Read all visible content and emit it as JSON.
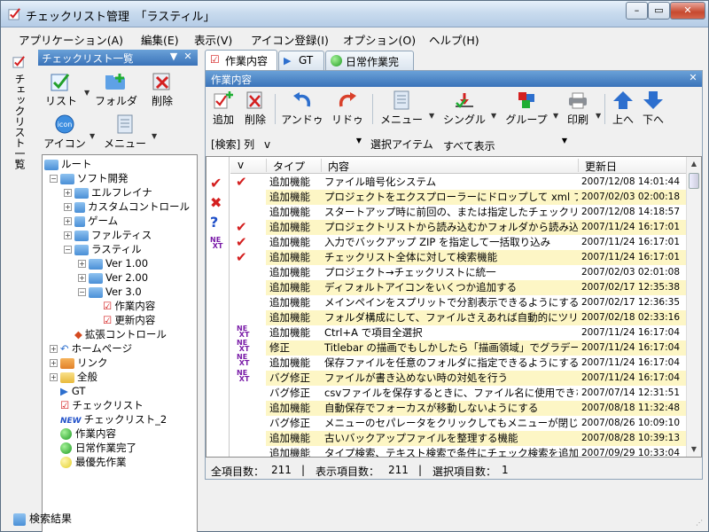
{
  "window": {
    "title": "チェックリスト管理　「ラスティル」",
    "min": "–",
    "max": "▭",
    "close": "✕"
  },
  "menu": [
    "アプリケーション(A)",
    "編集(E)",
    "表示(V)",
    "アイコン登録(I)",
    "オプション(O)",
    "ヘルプ(H)"
  ],
  "side_tab": {
    "label": "チェックリスト一覧"
  },
  "left_panel": {
    "title": "チェックリスト一覧",
    "pin": "▼",
    "close": "✕",
    "toolbar": [
      {
        "label": "リスト",
        "icon": "checklist-icon"
      },
      {
        "label": "フォルダ",
        "icon": "folder-add-icon"
      },
      {
        "label": "削除",
        "icon": "delete-icon"
      },
      {
        "label": "アイコン",
        "icon": "icon-register-icon"
      },
      {
        "label": "メニュー",
        "icon": "menu-icon"
      }
    ],
    "tree": [
      {
        "label": "ルート",
        "level": 0,
        "exp": "",
        "icon": "folder-blue"
      },
      {
        "label": "ソフト開発",
        "level": 1,
        "exp": "−",
        "icon": "folder-blue"
      },
      {
        "label": "エルフレイナ",
        "level": 2,
        "exp": "+",
        "icon": "folder-blue"
      },
      {
        "label": "カスタムコントロール",
        "level": 2,
        "exp": "+",
        "icon": "flag-blue"
      },
      {
        "label": "ゲーム",
        "level": 2,
        "exp": "+",
        "icon": "flag-blue"
      },
      {
        "label": "ファルティス",
        "level": 2,
        "exp": "+",
        "icon": "folder-blue"
      },
      {
        "label": "ラスティル",
        "level": 2,
        "exp": "−",
        "icon": "folder-blue"
      },
      {
        "label": "Ver 1.00",
        "level": 3,
        "exp": "+",
        "icon": "folder-blue"
      },
      {
        "label": "Ver 2.00",
        "level": 3,
        "exp": "+",
        "icon": "folder-blue"
      },
      {
        "label": "Ver 3.0",
        "level": 3,
        "exp": "−",
        "icon": "folder-blue"
      },
      {
        "label": "作業内容",
        "level": 4,
        "exp": "",
        "icon": "check"
      },
      {
        "label": "更新内容",
        "level": 4,
        "exp": "",
        "icon": "check"
      },
      {
        "label": "拡張コントロール",
        "level": 2,
        "exp": "",
        "icon": "multi"
      },
      {
        "label": "ホームページ",
        "level": 1,
        "exp": "+",
        "icon": "undo"
      },
      {
        "label": "リンク",
        "level": 1,
        "exp": "+",
        "icon": "folder-orange"
      },
      {
        "label": "全般",
        "level": 1,
        "exp": "+",
        "icon": "folder-yellow"
      },
      {
        "label": "GT",
        "level": 1,
        "exp": "",
        "icon": "arrow"
      },
      {
        "label": "チェックリスト",
        "level": 1,
        "exp": "",
        "icon": "check"
      },
      {
        "label": "チェックリスト_2",
        "level": 1,
        "exp": "",
        "icon": "new"
      },
      {
        "label": "作業内容",
        "level": 1,
        "exp": "",
        "icon": "green"
      },
      {
        "label": "日常作業完了",
        "level": 1,
        "exp": "",
        "icon": "green"
      },
      {
        "label": "最優先作業",
        "level": 1,
        "exp": "",
        "icon": "yellow"
      }
    ]
  },
  "tabs": [
    {
      "label": "作業内容",
      "icon": "check-icon"
    },
    {
      "label": "GT",
      "icon": "arrow-icon"
    },
    {
      "label": "日常作業完了",
      "icon": "green-dot-icon"
    }
  ],
  "pane": {
    "title": "作業内容",
    "close": "✕",
    "toolbar": [
      {
        "label": "追加",
        "icon": "add-icon"
      },
      {
        "label": "削除",
        "icon": "delete-icon"
      },
      {
        "label": "アンドゥ",
        "icon": "undo-icon"
      },
      {
        "label": "リドゥ",
        "icon": "redo-icon"
      },
      {
        "label": "メニュー",
        "icon": "menu-icon"
      },
      {
        "label": "シングル",
        "icon": "single-icon"
      },
      {
        "label": "グループ",
        "icon": "group-icon"
      },
      {
        "label": "印刷",
        "icon": "print-icon"
      },
      {
        "label": "上へ",
        "icon": "up-icon"
      },
      {
        "label": "下へ",
        "icon": "down-icon"
      }
    ],
    "filter": {
      "label": "[検索] 列",
      "column": "v",
      "item_label": "選択アイテム",
      "item": "すべて表示"
    },
    "columns": [
      "v",
      "タイプ",
      "内容",
      "更新日"
    ],
    "rows": [
      {
        "c": true,
        "t": "追加機能",
        "x": "ファイル暗号化システム",
        "d": "2007/12/08 14:01:44",
        "h": false
      },
      {
        "c": false,
        "t": "追加機能",
        "x": "プロジェクトをエクスプローラーにドロップして xml ファイル外部…",
        "d": "2007/02/03 02:00:18",
        "h": true
      },
      {
        "c": false,
        "t": "追加機能",
        "x": "スタートアップ時に前回の、または指定したチェックリストを自動…",
        "d": "2007/12/08 14:18:57",
        "h": false
      },
      {
        "c": true,
        "t": "追加機能",
        "x": "プロジェクトリストから読み込むかフォルダから読み込むかを選…",
        "d": "2007/11/24 16:17:01",
        "h": true
      },
      {
        "c": true,
        "t": "追加機能",
        "x": "入力でバックアップ ZIP を指定して一括取り込み",
        "d": "2007/11/24 16:17:01",
        "h": false
      },
      {
        "c": true,
        "t": "追加機能",
        "x": "チェックリスト全体に対して検索機能",
        "d": "2007/11/24 16:17:01",
        "h": true
      },
      {
        "c": false,
        "t": "追加機能",
        "x": "プロジェクト→チェックリストに統一",
        "d": "2007/02/03 02:01:08",
        "h": false
      },
      {
        "c": false,
        "t": "追加機能",
        "x": "ディフォルトアイコンをいくつか追加する",
        "d": "2007/02/17 12:35:38",
        "h": true
      },
      {
        "c": false,
        "t": "追加機能",
        "x": "メインペインをスプリットで分割表示できるようにする",
        "d": "2007/02/17 12:36:35",
        "h": false
      },
      {
        "c": false,
        "t": "追加機能",
        "x": "フォルダ構成にして、ファイルさえあれば自動的にツリーに表示…",
        "d": "2007/02/18 02:33:16",
        "h": true
      },
      {
        "c": false,
        "t": "追加機能",
        "x": "Ctrl+A で項目全選択",
        "d": "2007/11/24 16:17:04",
        "h": false
      },
      {
        "c": false,
        "t": "修正",
        "x": "Titlebar の描画でもしかしたら「描画領域」でグラデーション…",
        "d": "2007/11/24 16:17:04",
        "h": true
      },
      {
        "c": false,
        "t": "追加機能",
        "x": "保存ファイルを任意のフォルダに指定できるようにする",
        "d": "2007/11/24 16:17:04",
        "h": false
      },
      {
        "c": false,
        "t": "バグ修正",
        "x": "ファイルが書き込めない時の対処を行う",
        "d": "2007/11/24 16:17:04",
        "h": true
      },
      {
        "c": false,
        "t": "バグ修正",
        "x": "csvファイルを保存するときに、ファイル名に使用できない文字…",
        "d": "2007/07/14 12:31:51",
        "h": false
      },
      {
        "c": false,
        "t": "追加機能",
        "x": "自動保存でフォーカスが移動しないようにする",
        "d": "2007/08/18 11:32:48",
        "h": true
      },
      {
        "c": false,
        "t": "バグ修正",
        "x": "メニューのセパレータをクリックしてもメニューが閉じないように…",
        "d": "2007/08/26 10:09:10",
        "h": false
      },
      {
        "c": false,
        "t": "追加機能",
        "x": "古いバックアップファイルを整理する機能",
        "d": "2007/08/28 10:39:13",
        "h": true
      },
      {
        "c": false,
        "t": "追加機能",
        "x": "タイプ検索、テキスト検索で条件にチェック検索を追加",
        "d": "2007/09/29 10:33:04",
        "h": false
      }
    ],
    "status": {
      "total_label": "全項目数：",
      "total": "211",
      "sep1": "|",
      "shown_label": "表示項目数：",
      "shown": "211",
      "sep2": "|",
      "sel_label": "選択項目数：",
      "sel": "1"
    }
  },
  "bottom_tab": {
    "label": "検索結果"
  }
}
